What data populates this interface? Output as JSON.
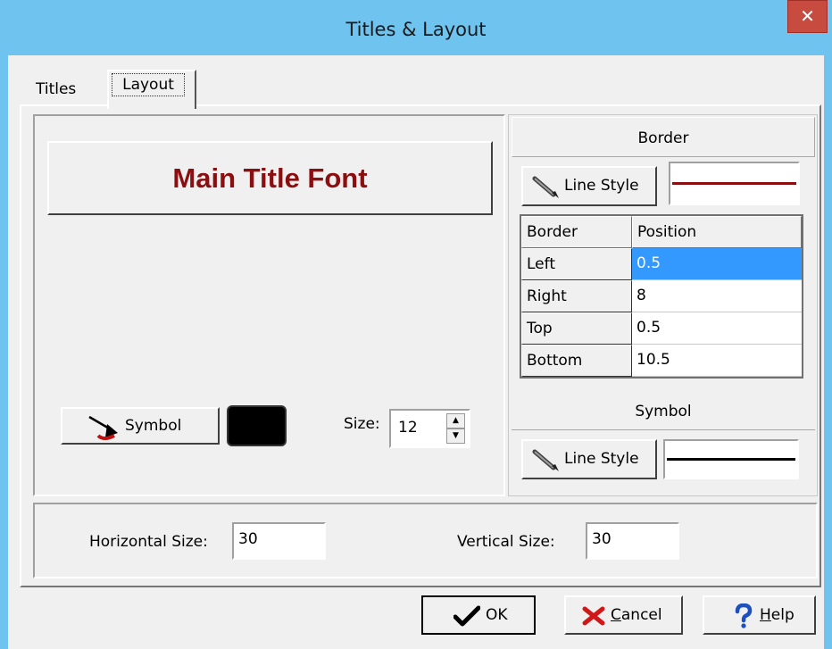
{
  "window": {
    "title": "Titles & Layout",
    "close_glyph": "✕"
  },
  "tabs": [
    {
      "label": "Titles"
    },
    {
      "label": "Layout"
    }
  ],
  "main_title_font_button": {
    "label": "Main Title Font",
    "color": "#8b0f10"
  },
  "symbol": {
    "button_label": "Symbol",
    "swatch_color": "#000000",
    "size_label": "Size:",
    "size_value": "12"
  },
  "border": {
    "header": "Border",
    "line_style_label": "Line Style",
    "line_color": "#8b0f10",
    "columns": [
      "Border",
      "Position"
    ],
    "rows": [
      {
        "name": "Left",
        "value": "0.5",
        "selected": true
      },
      {
        "name": "Right",
        "value": "8"
      },
      {
        "name": "Top",
        "value": "0.5"
      },
      {
        "name": "Bottom",
        "value": "10.5"
      }
    ]
  },
  "symbol_section": {
    "header": "Symbol",
    "line_style_label": "Line Style",
    "line_color": "#000000"
  },
  "size_fields": {
    "horizontal_label": "Horizontal Size:",
    "horizontal_value": "30",
    "vertical_label": "Vertical Size:",
    "vertical_value": "30"
  },
  "dialog_buttons": {
    "ok": "OK",
    "cancel_rest": "ancel",
    "cancel_mnemonic": "C",
    "help_rest": "elp",
    "help_mnemonic": "H"
  },
  "icons": {
    "symbol": "marker-arrow-icon",
    "line_style": "pencil-icon",
    "ok": "checkmark-icon",
    "cancel": "red-x-icon",
    "help": "question-mark-icon"
  }
}
